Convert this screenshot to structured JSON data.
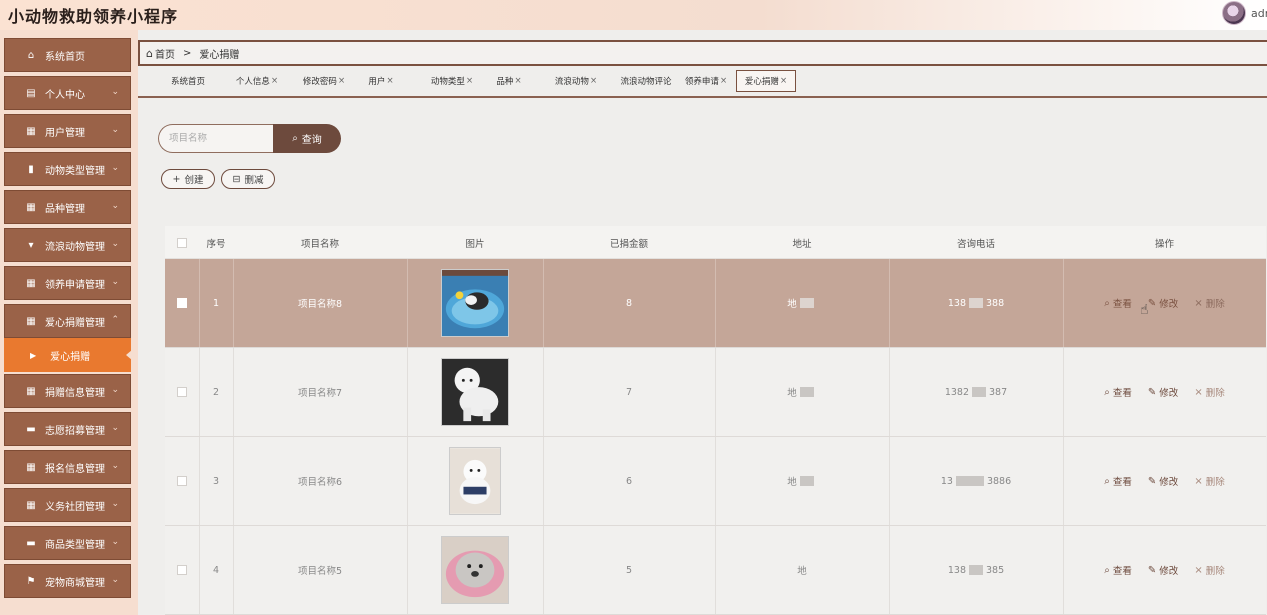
{
  "header": {
    "app_title": "小动物救助领养小程序",
    "user": "adm"
  },
  "sidebar": {
    "items": [
      {
        "label": "系统首页"
      },
      {
        "label": "个人中心"
      },
      {
        "label": "用户管理"
      },
      {
        "label": "动物类型管理"
      },
      {
        "label": "品种管理"
      },
      {
        "label": "流浪动物管理"
      },
      {
        "label": "领养申请管理"
      },
      {
        "label": "爱心捐赠管理"
      },
      {
        "label": "捐赠信息管理"
      },
      {
        "label": "志愿招募管理"
      },
      {
        "label": "报名信息管理"
      },
      {
        "label": "义务社团管理"
      },
      {
        "label": "商品类型管理"
      },
      {
        "label": "宠物商城管理"
      }
    ],
    "active_sub": "爱心捐赠"
  },
  "breadcrumb": {
    "home": "首页",
    "separator": ">",
    "current": "爱心捐赠"
  },
  "tabs": [
    {
      "label": "系统首页",
      "closable": false
    },
    {
      "label": "个人信息",
      "closable": true
    },
    {
      "label": "修改密码",
      "closable": true
    },
    {
      "label": "用户",
      "closable": true
    },
    {
      "label": "动物类型",
      "closable": true
    },
    {
      "label": "品种",
      "closable": true
    },
    {
      "label": "流浪动物",
      "closable": true
    },
    {
      "label": "流浪动物评论",
      "closable": false
    },
    {
      "label": "领养申请",
      "closable": true
    },
    {
      "label": "爱心捐赠",
      "closable": true,
      "active": true
    }
  ],
  "search": {
    "placeholder": "项目名称",
    "button": "查询"
  },
  "actions": {
    "create": "创建",
    "delete": "删减"
  },
  "table": {
    "headers": [
      "序号",
      "项目名称",
      "图片",
      "已捐金额",
      "地址",
      "咨询电话",
      "操作"
    ],
    "rows": [
      {
        "index": "1",
        "name": "项目名称8",
        "amount": "8",
        "address": "地",
        "phone_a": "138",
        "phone_b": "388",
        "image": "dog-in-pool"
      },
      {
        "index": "2",
        "name": "项目名称7",
        "amount": "7",
        "address": "地",
        "phone_a": "1382",
        "phone_b": "387",
        "image": "white-poodle"
      },
      {
        "index": "3",
        "name": "项目名称6",
        "amount": "6",
        "address": "地",
        "phone_a": "13",
        "phone_b": "3886",
        "image": "white-pomeranian"
      },
      {
        "index": "4",
        "name": "项目名称5",
        "amount": "5",
        "address": "地",
        "phone_a": "138",
        "phone_b": "385",
        "image": "dog-in-pink-bed"
      }
    ],
    "ops": {
      "view": "查看",
      "edit": "修改",
      "delete": "删除"
    }
  }
}
